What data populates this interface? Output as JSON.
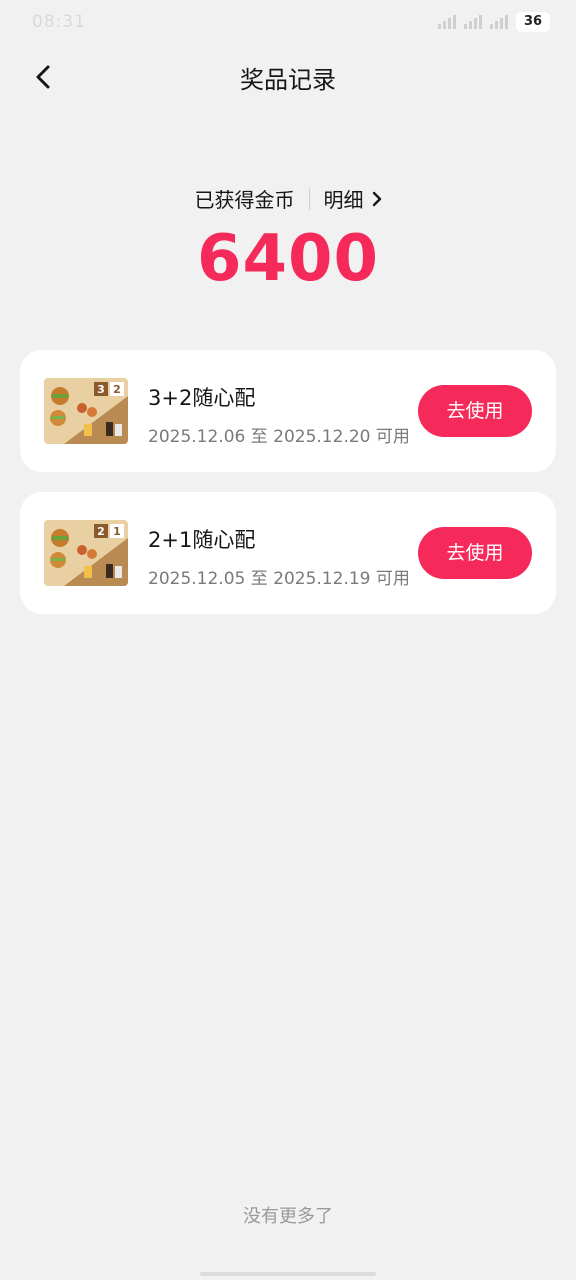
{
  "status_bar": {
    "time": "08:31",
    "battery": "36"
  },
  "header": {
    "title": "奖品记录",
    "back_icon": "chevron-left-icon"
  },
  "coins": {
    "label": "已获得金币",
    "detail_label": "明细",
    "detail_icon": "chevron-right-icon",
    "value": "6400",
    "accent_color": "#f52a5a"
  },
  "coupons": [
    {
      "name": "3+2随心配",
      "validity": "2025.12.06 至 2025.12.20 可用",
      "button_label": "去使用",
      "thumb_badge_a": "3",
      "thumb_badge_b": "2"
    },
    {
      "name": "2+1随心配",
      "validity": "2025.12.05 至 2025.12.19 可用",
      "button_label": "去使用",
      "thumb_badge_a": "2",
      "thumb_badge_b": "1"
    }
  ],
  "footer": {
    "no_more": "没有更多了"
  }
}
